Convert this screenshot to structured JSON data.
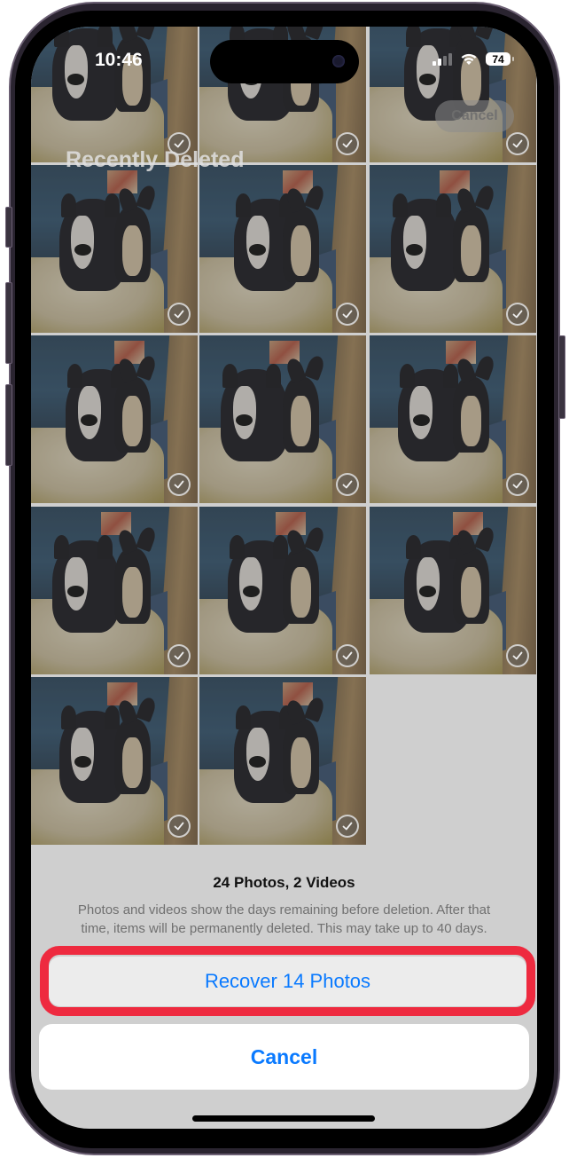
{
  "status_bar": {
    "time": "10:46",
    "signal_bars_filled": 2,
    "signal_bars_total": 4,
    "wifi": "wifi-icon",
    "battery_percent": "74"
  },
  "header": {
    "title": "Recently Deleted",
    "cancel_label": "Cancel"
  },
  "grid": {
    "columns": 3,
    "items": [
      {
        "type": "photo",
        "selected": true,
        "icon": "checkmark-circle-icon"
      },
      {
        "type": "photo",
        "selected": true,
        "icon": "checkmark-circle-icon"
      },
      {
        "type": "photo",
        "selected": true,
        "icon": "checkmark-circle-icon"
      },
      {
        "type": "photo",
        "selected": true,
        "icon": "checkmark-circle-icon"
      },
      {
        "type": "photo",
        "selected": true,
        "icon": "checkmark-circle-icon"
      },
      {
        "type": "photo",
        "selected": true,
        "icon": "checkmark-circle-icon"
      },
      {
        "type": "photo",
        "selected": true,
        "icon": "checkmark-circle-icon"
      },
      {
        "type": "photo",
        "selected": true,
        "icon": "checkmark-circle-icon"
      },
      {
        "type": "photo",
        "selected": true,
        "icon": "checkmark-circle-icon"
      },
      {
        "type": "photo",
        "selected": true,
        "icon": "checkmark-circle-icon"
      },
      {
        "type": "photo",
        "selected": true,
        "icon": "checkmark-circle-icon"
      },
      {
        "type": "photo",
        "selected": true,
        "icon": "checkmark-circle-icon"
      },
      {
        "type": "photo",
        "selected": true,
        "icon": "checkmark-circle-icon"
      },
      {
        "type": "photo",
        "selected": true,
        "icon": "checkmark-circle-icon"
      }
    ]
  },
  "action_sheet": {
    "title": "24 Photos, 2 Videos",
    "description": "Photos and videos show the days remaining before deletion. After that time, items will be permanently deleted. This may take up to 40 days.",
    "recover_label": "Recover 14 Photos",
    "cancel_label": "Cancel",
    "highlight_color": "#ee2a3f",
    "action_color": "#0a7aff"
  }
}
